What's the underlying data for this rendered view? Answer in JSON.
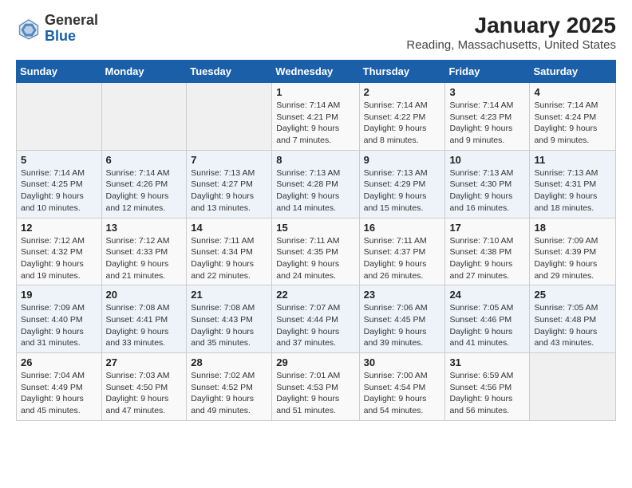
{
  "header": {
    "logo_general": "General",
    "logo_blue": "Blue",
    "title": "January 2025",
    "subtitle": "Reading, Massachusetts, United States"
  },
  "days_of_week": [
    "Sunday",
    "Monday",
    "Tuesday",
    "Wednesday",
    "Thursday",
    "Friday",
    "Saturday"
  ],
  "weeks": [
    [
      {
        "num": "",
        "info": ""
      },
      {
        "num": "",
        "info": ""
      },
      {
        "num": "",
        "info": ""
      },
      {
        "num": "1",
        "info": "Sunrise: 7:14 AM\nSunset: 4:21 PM\nDaylight: 9 hours and 7 minutes."
      },
      {
        "num": "2",
        "info": "Sunrise: 7:14 AM\nSunset: 4:22 PM\nDaylight: 9 hours and 8 minutes."
      },
      {
        "num": "3",
        "info": "Sunrise: 7:14 AM\nSunset: 4:23 PM\nDaylight: 9 hours and 9 minutes."
      },
      {
        "num": "4",
        "info": "Sunrise: 7:14 AM\nSunset: 4:24 PM\nDaylight: 9 hours and 9 minutes."
      }
    ],
    [
      {
        "num": "5",
        "info": "Sunrise: 7:14 AM\nSunset: 4:25 PM\nDaylight: 9 hours and 10 minutes."
      },
      {
        "num": "6",
        "info": "Sunrise: 7:14 AM\nSunset: 4:26 PM\nDaylight: 9 hours and 12 minutes."
      },
      {
        "num": "7",
        "info": "Sunrise: 7:13 AM\nSunset: 4:27 PM\nDaylight: 9 hours and 13 minutes."
      },
      {
        "num": "8",
        "info": "Sunrise: 7:13 AM\nSunset: 4:28 PM\nDaylight: 9 hours and 14 minutes."
      },
      {
        "num": "9",
        "info": "Sunrise: 7:13 AM\nSunset: 4:29 PM\nDaylight: 9 hours and 15 minutes."
      },
      {
        "num": "10",
        "info": "Sunrise: 7:13 AM\nSunset: 4:30 PM\nDaylight: 9 hours and 16 minutes."
      },
      {
        "num": "11",
        "info": "Sunrise: 7:13 AM\nSunset: 4:31 PM\nDaylight: 9 hours and 18 minutes."
      }
    ],
    [
      {
        "num": "12",
        "info": "Sunrise: 7:12 AM\nSunset: 4:32 PM\nDaylight: 9 hours and 19 minutes."
      },
      {
        "num": "13",
        "info": "Sunrise: 7:12 AM\nSunset: 4:33 PM\nDaylight: 9 hours and 21 minutes."
      },
      {
        "num": "14",
        "info": "Sunrise: 7:11 AM\nSunset: 4:34 PM\nDaylight: 9 hours and 22 minutes."
      },
      {
        "num": "15",
        "info": "Sunrise: 7:11 AM\nSunset: 4:35 PM\nDaylight: 9 hours and 24 minutes."
      },
      {
        "num": "16",
        "info": "Sunrise: 7:11 AM\nSunset: 4:37 PM\nDaylight: 9 hours and 26 minutes."
      },
      {
        "num": "17",
        "info": "Sunrise: 7:10 AM\nSunset: 4:38 PM\nDaylight: 9 hours and 27 minutes."
      },
      {
        "num": "18",
        "info": "Sunrise: 7:09 AM\nSunset: 4:39 PM\nDaylight: 9 hours and 29 minutes."
      }
    ],
    [
      {
        "num": "19",
        "info": "Sunrise: 7:09 AM\nSunset: 4:40 PM\nDaylight: 9 hours and 31 minutes."
      },
      {
        "num": "20",
        "info": "Sunrise: 7:08 AM\nSunset: 4:41 PM\nDaylight: 9 hours and 33 minutes."
      },
      {
        "num": "21",
        "info": "Sunrise: 7:08 AM\nSunset: 4:43 PM\nDaylight: 9 hours and 35 minutes."
      },
      {
        "num": "22",
        "info": "Sunrise: 7:07 AM\nSunset: 4:44 PM\nDaylight: 9 hours and 37 minutes."
      },
      {
        "num": "23",
        "info": "Sunrise: 7:06 AM\nSunset: 4:45 PM\nDaylight: 9 hours and 39 minutes."
      },
      {
        "num": "24",
        "info": "Sunrise: 7:05 AM\nSunset: 4:46 PM\nDaylight: 9 hours and 41 minutes."
      },
      {
        "num": "25",
        "info": "Sunrise: 7:05 AM\nSunset: 4:48 PM\nDaylight: 9 hours and 43 minutes."
      }
    ],
    [
      {
        "num": "26",
        "info": "Sunrise: 7:04 AM\nSunset: 4:49 PM\nDaylight: 9 hours and 45 minutes."
      },
      {
        "num": "27",
        "info": "Sunrise: 7:03 AM\nSunset: 4:50 PM\nDaylight: 9 hours and 47 minutes."
      },
      {
        "num": "28",
        "info": "Sunrise: 7:02 AM\nSunset: 4:52 PM\nDaylight: 9 hours and 49 minutes."
      },
      {
        "num": "29",
        "info": "Sunrise: 7:01 AM\nSunset: 4:53 PM\nDaylight: 9 hours and 51 minutes."
      },
      {
        "num": "30",
        "info": "Sunrise: 7:00 AM\nSunset: 4:54 PM\nDaylight: 9 hours and 54 minutes."
      },
      {
        "num": "31",
        "info": "Sunrise: 6:59 AM\nSunset: 4:56 PM\nDaylight: 9 hours and 56 minutes."
      },
      {
        "num": "",
        "info": ""
      }
    ]
  ]
}
